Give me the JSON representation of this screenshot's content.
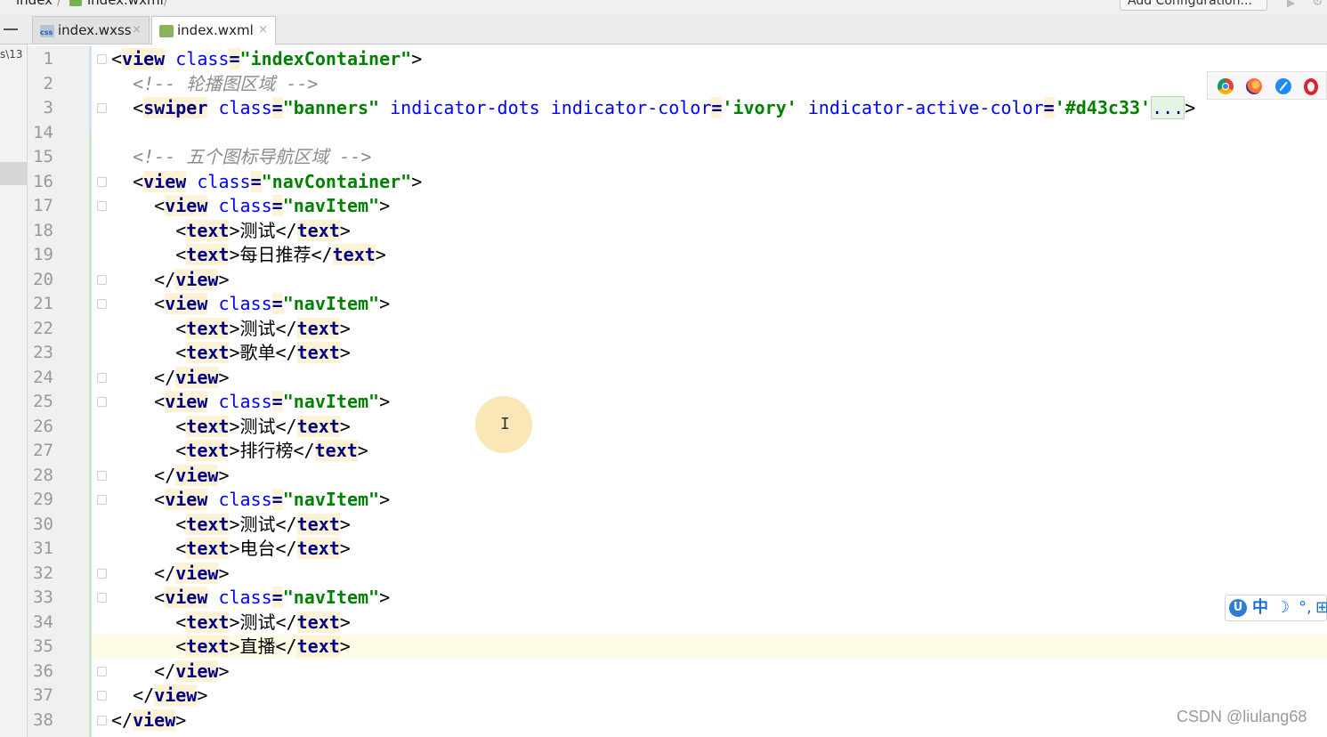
{
  "breadcrumb": {
    "part1": "index",
    "sep": "/",
    "part2": "index.wxml"
  },
  "toolbar": {
    "add_config_label": "Add Configuration...",
    "run_icon": "run-icon",
    "settings_icon": "gear-icon"
  },
  "left_panel": {
    "path_fragment": "s\\13"
  },
  "tabs": [
    {
      "label": "index.wxss",
      "icon": "css-file-icon",
      "close": "×",
      "active": false
    },
    {
      "label": "index.wxml",
      "icon": "html-file-icon",
      "close": "×",
      "active": true
    }
  ],
  "browsers": [
    "chrome-icon",
    "firefox-icon",
    "safari-icon",
    "opera-icon"
  ],
  "ime": {
    "logo": "U",
    "mode": "中",
    "moon": "☽",
    "punct": "°,",
    "keyboard": "⊞"
  },
  "cursor": "I",
  "watermark": "CSDN @liulang68",
  "colors": {
    "tag": "#000080",
    "attribute": "#0000ff",
    "value": "#008000",
    "comment": "#8c8c8c",
    "current_line": "#fefbe6"
  },
  "code_lines": [
    {
      "n": "1",
      "segs": [
        [
          "p",
          "<"
        ],
        [
          "t",
          "view"
        ],
        [
          "s",
          " "
        ],
        [
          "a",
          "class"
        ],
        [
          "p",
          "="
        ],
        [
          "v",
          "\"indexContainer\""
        ],
        [
          "p",
          ">"
        ]
      ]
    },
    {
      "n": "2",
      "segs": [
        [
          "i",
          "  "
        ],
        [
          "c",
          "<!-- 轮播图区域 -->"
        ]
      ]
    },
    {
      "n": "3",
      "segs": [
        [
          "i",
          "  "
        ],
        [
          "p",
          "<"
        ],
        [
          "t",
          "swiper"
        ],
        [
          "s",
          " "
        ],
        [
          "a",
          "class"
        ],
        [
          "p",
          "="
        ],
        [
          "v",
          "\"banners\""
        ],
        [
          "s",
          " "
        ],
        [
          "a",
          "indicator-dots"
        ],
        [
          "s",
          " "
        ],
        [
          "a",
          "indicator-color"
        ],
        [
          "p",
          "="
        ],
        [
          "v",
          "'ivory'"
        ],
        [
          "s",
          " "
        ],
        [
          "a",
          "indicator-active-color"
        ],
        [
          "p",
          "="
        ],
        [
          "v",
          "'#d43c33'"
        ],
        [
          "e",
          "..."
        ],
        [
          "p",
          ">"
        ]
      ]
    },
    {
      "n": "14",
      "segs": []
    },
    {
      "n": "15",
      "segs": [
        [
          "i",
          "  "
        ],
        [
          "c",
          "<!-- 五个图标导航区域 -->"
        ]
      ]
    },
    {
      "n": "16",
      "segs": [
        [
          "i",
          "  "
        ],
        [
          "p",
          "<"
        ],
        [
          "t",
          "view"
        ],
        [
          "s",
          " "
        ],
        [
          "a",
          "class"
        ],
        [
          "p",
          "="
        ],
        [
          "v",
          "\"navContainer\""
        ],
        [
          "p",
          ">"
        ]
      ]
    },
    {
      "n": "17",
      "segs": [
        [
          "i",
          "    "
        ],
        [
          "p",
          "<"
        ],
        [
          "t",
          "view"
        ],
        [
          "s",
          " "
        ],
        [
          "a",
          "class"
        ],
        [
          "p",
          "="
        ],
        [
          "v",
          "\"navItem\""
        ],
        [
          "p",
          ">"
        ]
      ]
    },
    {
      "n": "18",
      "segs": [
        [
          "i",
          "      "
        ],
        [
          "p",
          "<"
        ],
        [
          "t",
          "text"
        ],
        [
          "p",
          ">"
        ],
        [
          "x",
          "测试"
        ],
        [
          "p",
          "</"
        ],
        [
          "t",
          "text"
        ],
        [
          "p",
          ">"
        ]
      ]
    },
    {
      "n": "19",
      "segs": [
        [
          "i",
          "      "
        ],
        [
          "p",
          "<"
        ],
        [
          "t",
          "text"
        ],
        [
          "p",
          ">"
        ],
        [
          "x",
          "每日推荐"
        ],
        [
          "p",
          "</"
        ],
        [
          "t",
          "text"
        ],
        [
          "p",
          ">"
        ]
      ]
    },
    {
      "n": "20",
      "segs": [
        [
          "i",
          "    "
        ],
        [
          "p",
          "</"
        ],
        [
          "t",
          "view"
        ],
        [
          "p",
          ">"
        ]
      ]
    },
    {
      "n": "21",
      "segs": [
        [
          "i",
          "    "
        ],
        [
          "p",
          "<"
        ],
        [
          "t",
          "view"
        ],
        [
          "s",
          " "
        ],
        [
          "a",
          "class"
        ],
        [
          "p",
          "="
        ],
        [
          "v",
          "\"navItem\""
        ],
        [
          "p",
          ">"
        ]
      ]
    },
    {
      "n": "22",
      "segs": [
        [
          "i",
          "      "
        ],
        [
          "p",
          "<"
        ],
        [
          "t",
          "text"
        ],
        [
          "p",
          ">"
        ],
        [
          "x",
          "测试"
        ],
        [
          "p",
          "</"
        ],
        [
          "t",
          "text"
        ],
        [
          "p",
          ">"
        ]
      ]
    },
    {
      "n": "23",
      "segs": [
        [
          "i",
          "      "
        ],
        [
          "p",
          "<"
        ],
        [
          "t",
          "text"
        ],
        [
          "p",
          ">"
        ],
        [
          "x",
          "歌单"
        ],
        [
          "p",
          "</"
        ],
        [
          "t",
          "text"
        ],
        [
          "p",
          ">"
        ]
      ]
    },
    {
      "n": "24",
      "segs": [
        [
          "i",
          "    "
        ],
        [
          "p",
          "</"
        ],
        [
          "t",
          "view"
        ],
        [
          "p",
          ">"
        ]
      ]
    },
    {
      "n": "25",
      "segs": [
        [
          "i",
          "    "
        ],
        [
          "p",
          "<"
        ],
        [
          "t",
          "view"
        ],
        [
          "s",
          " "
        ],
        [
          "a",
          "class"
        ],
        [
          "p",
          "="
        ],
        [
          "v",
          "\"navItem\""
        ],
        [
          "p",
          ">"
        ]
      ]
    },
    {
      "n": "26",
      "segs": [
        [
          "i",
          "      "
        ],
        [
          "p",
          "<"
        ],
        [
          "t",
          "text"
        ],
        [
          "p",
          ">"
        ],
        [
          "x",
          "测试"
        ],
        [
          "p",
          "</"
        ],
        [
          "t",
          "text"
        ],
        [
          "p",
          ">"
        ]
      ]
    },
    {
      "n": "27",
      "segs": [
        [
          "i",
          "      "
        ],
        [
          "p",
          "<"
        ],
        [
          "t",
          "text"
        ],
        [
          "p",
          ">"
        ],
        [
          "x",
          "排行榜"
        ],
        [
          "p",
          "</"
        ],
        [
          "t",
          "text"
        ],
        [
          "p",
          ">"
        ]
      ]
    },
    {
      "n": "28",
      "segs": [
        [
          "i",
          "    "
        ],
        [
          "p",
          "</"
        ],
        [
          "t",
          "view"
        ],
        [
          "p",
          ">"
        ]
      ]
    },
    {
      "n": "29",
      "segs": [
        [
          "i",
          "    "
        ],
        [
          "p",
          "<"
        ],
        [
          "t",
          "view"
        ],
        [
          "s",
          " "
        ],
        [
          "a",
          "class"
        ],
        [
          "p",
          "="
        ],
        [
          "v",
          "\"navItem\""
        ],
        [
          "p",
          ">"
        ]
      ]
    },
    {
      "n": "30",
      "segs": [
        [
          "i",
          "      "
        ],
        [
          "p",
          "<"
        ],
        [
          "t",
          "text"
        ],
        [
          "p",
          ">"
        ],
        [
          "x",
          "测试"
        ],
        [
          "p",
          "</"
        ],
        [
          "t",
          "text"
        ],
        [
          "p",
          ">"
        ]
      ]
    },
    {
      "n": "31",
      "segs": [
        [
          "i",
          "      "
        ],
        [
          "p",
          "<"
        ],
        [
          "t",
          "text"
        ],
        [
          "p",
          ">"
        ],
        [
          "x",
          "电台"
        ],
        [
          "p",
          "</"
        ],
        [
          "t",
          "text"
        ],
        [
          "p",
          ">"
        ]
      ]
    },
    {
      "n": "32",
      "segs": [
        [
          "i",
          "    "
        ],
        [
          "p",
          "</"
        ],
        [
          "t",
          "view"
        ],
        [
          "p",
          ">"
        ]
      ]
    },
    {
      "n": "33",
      "segs": [
        [
          "i",
          "    "
        ],
        [
          "p",
          "<"
        ],
        [
          "t",
          "view"
        ],
        [
          "s",
          " "
        ],
        [
          "a",
          "class"
        ],
        [
          "p",
          "="
        ],
        [
          "v",
          "\"navItem\""
        ],
        [
          "p",
          ">"
        ]
      ]
    },
    {
      "n": "34",
      "segs": [
        [
          "i",
          "      "
        ],
        [
          "p",
          "<"
        ],
        [
          "t",
          "text"
        ],
        [
          "p",
          ">"
        ],
        [
          "x",
          "测试"
        ],
        [
          "p",
          "</"
        ],
        [
          "t",
          "text"
        ],
        [
          "p",
          ">"
        ]
      ]
    },
    {
      "n": "35",
      "segs": [
        [
          "i",
          "      "
        ],
        [
          "p",
          "<"
        ],
        [
          "t",
          "text"
        ],
        [
          "p",
          ">"
        ],
        [
          "x",
          "直播"
        ],
        [
          "p",
          "</"
        ],
        [
          "t",
          "text"
        ],
        [
          "p",
          ">"
        ]
      ]
    },
    {
      "n": "36",
      "segs": [
        [
          "i",
          "    "
        ],
        [
          "p",
          "</"
        ],
        [
          "t",
          "view"
        ],
        [
          "p",
          ">"
        ]
      ]
    },
    {
      "n": "37",
      "segs": [
        [
          "i",
          "  "
        ],
        [
          "p",
          "</"
        ],
        [
          "t",
          "view"
        ],
        [
          "p",
          ">"
        ]
      ]
    },
    {
      "n": "38",
      "segs": [
        [
          "p",
          "</"
        ],
        [
          "t",
          "view"
        ],
        [
          "p",
          ">"
        ]
      ]
    }
  ]
}
